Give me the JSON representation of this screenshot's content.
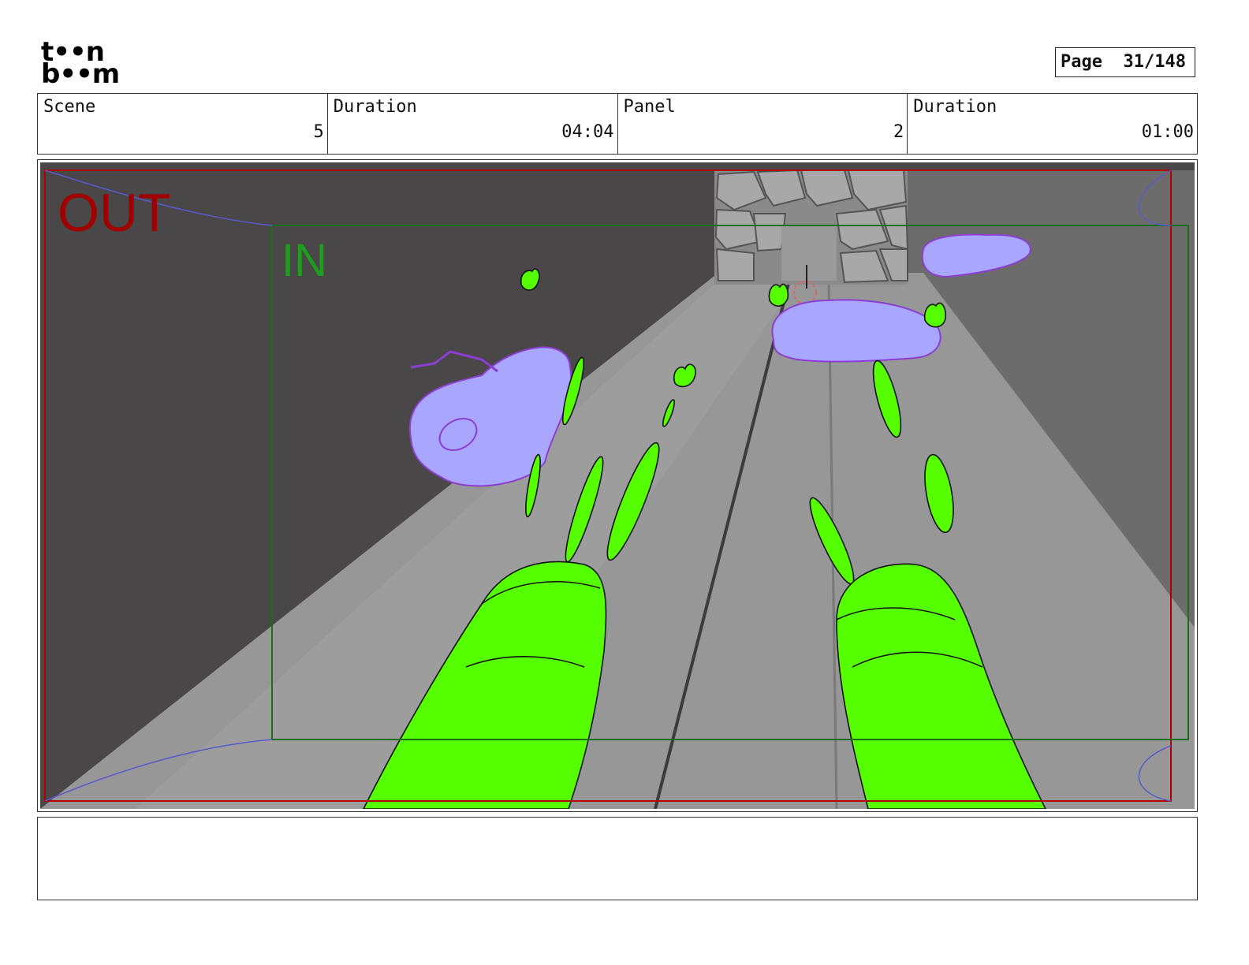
{
  "logo": {
    "line1": "t••n",
    "line2": "b••m",
    "name": "toon boom"
  },
  "page": {
    "label": "Page",
    "value": "31/148"
  },
  "info": [
    {
      "label": "Scene",
      "value": "5"
    },
    {
      "label": "Duration",
      "value": "04:04"
    },
    {
      "label": "Panel",
      "value": "2"
    },
    {
      "label": "Duration",
      "value": "01:00"
    }
  ],
  "panel": {
    "out_label": "OUT",
    "in_label": "IN",
    "colors": {
      "out_frame": "#b00000",
      "in_frame": "#1a6e1a",
      "green_fx": "#55ff00",
      "purple_fx": "#a9a6ff",
      "wall_dark": "#4a4748",
      "floor": "#979797"
    }
  },
  "notes": {
    "text": ""
  }
}
